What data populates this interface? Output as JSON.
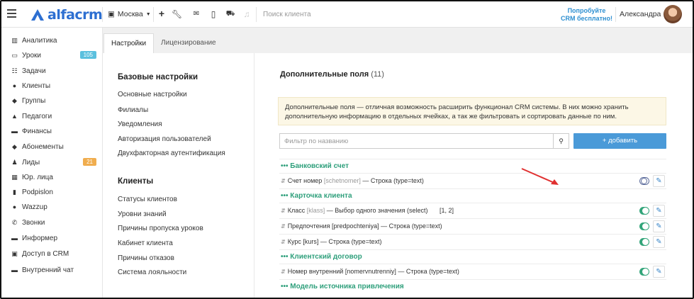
{
  "header": {
    "logo_text": "alfacrm",
    "city": "Москва",
    "search_placeholder": "Поиск клиента",
    "promo_line1": "Попробуйте",
    "promo_line2": "CRM бесплатно!",
    "user_name": "Александра",
    "icons": [
      "menu-icon",
      "map-marker-icon",
      "plus-icon",
      "wrench-icon",
      "mail-icon",
      "mobile-icon",
      "cart-icon",
      "bell-icon"
    ]
  },
  "sidebar": {
    "items": [
      {
        "label": "Аналитика",
        "icon": "analytics-icon"
      },
      {
        "label": "Уроки",
        "icon": "calendar-icon",
        "badge": "105",
        "badge_color": "#5bc0de"
      },
      {
        "label": "Задачи",
        "icon": "tasks-icon"
      },
      {
        "label": "Клиенты",
        "icon": "user-icon"
      },
      {
        "label": "Группы",
        "icon": "users-icon"
      },
      {
        "label": "Педагоги",
        "icon": "graduation-cap-icon"
      },
      {
        "label": "Финансы",
        "icon": "money-icon"
      },
      {
        "label": "Абонементы",
        "icon": "tag-icon"
      },
      {
        "label": "Лиды",
        "icon": "leads-icon",
        "badge": "21",
        "badge_color": "#f0ad4e"
      },
      {
        "label": "Юр. лица",
        "icon": "building-icon"
      },
      {
        "label": "Podpislon",
        "icon": "document-icon"
      },
      {
        "label": "Wazzup",
        "icon": "whatsapp-icon"
      },
      {
        "label": "Звонки",
        "icon": "phone-icon"
      },
      {
        "label": "Информер",
        "icon": "informer-icon"
      },
      {
        "label": "Доступ в CRM",
        "icon": "lock-icon"
      },
      {
        "label": "Внутренний чат",
        "icon": "chat-icon"
      }
    ]
  },
  "tabs": [
    {
      "label": "Настройки",
      "active": true
    },
    {
      "label": "Лицензирование",
      "active": false
    }
  ],
  "settings": {
    "basic_title": "Базовые настройки",
    "basic_links": [
      "Основные настройки",
      "Филиалы",
      "Уведомления",
      "Авторизация пользователей",
      "Двухфакторная аутентификация"
    ],
    "clients_title": "Клиенты",
    "client_links": [
      "Статусы клиентов",
      "Уровни знаний",
      "Причины пропуска уроков",
      "Кабинет клиента",
      "Причины отказов",
      "Система лояльности"
    ]
  },
  "fields": {
    "title": "Дополнительные поля",
    "count": "(11)",
    "info": "Дополнительные поля — отличная возможность расширить функционал CRM системы. В них можно хранить дополнительную информацию в отдельных ячейках, а так же фильтровать и сортировать данные по ним.",
    "filter_placeholder": "Фильтр по названию",
    "add_label": "+ добавить",
    "groups": [
      {
        "title": "••• Банковский счет",
        "rows": [
          {
            "name": "Счет номер",
            "key": "[schetnomer]",
            "type": "— Строка (type=text)",
            "values": "",
            "enabled": false
          }
        ]
      },
      {
        "title": "••• Карточка клиента",
        "rows": [
          {
            "name": "Класс",
            "key": "[klass]",
            "type": "— Выбор одного значения (select)",
            "values": "[1, 2]",
            "enabled": true
          },
          {
            "name": "Предпочтения",
            "key": "[predpochteniya]",
            "type": "— Строка (type=text)",
            "values": "",
            "enabled": true
          },
          {
            "name": "Курс",
            "key": "[kurs]",
            "type": "— Строка (type=text)",
            "values": "",
            "enabled": true
          }
        ]
      },
      {
        "title": "••• Клиентский договор",
        "rows": [
          {
            "name": "Номер внутренний",
            "key": "[nomervnutrenniy]",
            "type": "— Строка (type=text)",
            "values": "",
            "enabled": true
          }
        ]
      },
      {
        "title": "••• Модель источника привлечения",
        "rows": []
      }
    ]
  },
  "colors": {
    "brand": "#2d6fd1",
    "group_title": "#2e9f7b",
    "toggle_on": "#33a57a",
    "add_button": "#4a9ad8",
    "annotation_arrow": "#e03030"
  }
}
